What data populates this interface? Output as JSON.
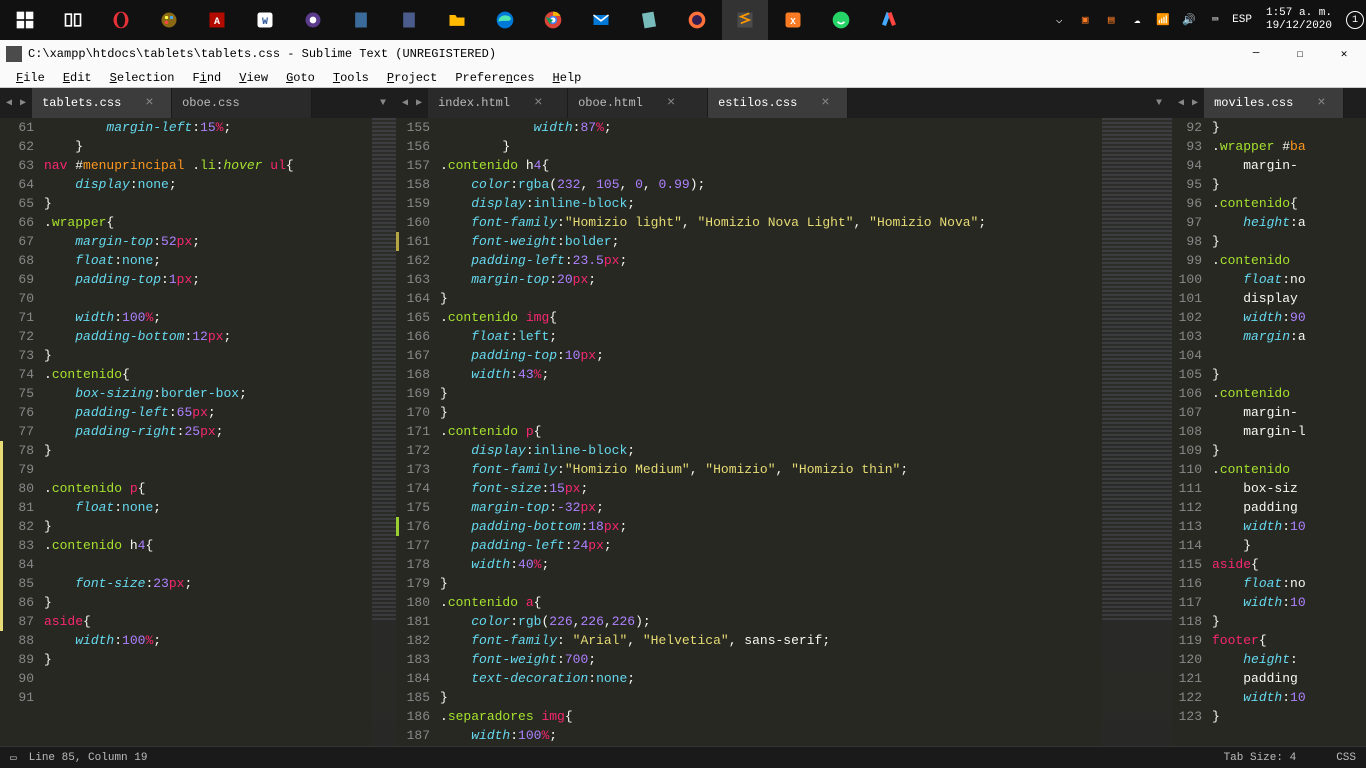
{
  "taskbar": {
    "clock_time": "1:57 a. m.",
    "clock_date": "19/12/2020",
    "lang": "ESP"
  },
  "window": {
    "title": "C:\\xampp\\htdocs\\tablets\\tablets.css - Sublime Text (UNREGISTERED)"
  },
  "menubar": [
    "File",
    "Edit",
    "Selection",
    "Find",
    "View",
    "Goto",
    "Tools",
    "Project",
    "Preferences",
    "Help"
  ],
  "tabgroups": {
    "g1": [
      {
        "label": "tablets.css",
        "active": true,
        "close": true
      },
      {
        "label": "oboe.css",
        "active": false,
        "close": false
      }
    ],
    "g2": [
      {
        "label": "index.html",
        "active": false,
        "close": true
      },
      {
        "label": "oboe.html",
        "active": false,
        "close": true
      },
      {
        "label": "estilos.css",
        "active": true,
        "close": true
      }
    ],
    "g3": [
      {
        "label": "moviles.css",
        "active": true,
        "close": true
      }
    ]
  },
  "statusbar": {
    "left": "Line 85, Column 19",
    "tabsize": "Tab Size: 4",
    "syntax": "CSS"
  },
  "pane1": {
    "start": 61,
    "lines": [
      "        margin-left:15%;",
      "    }",
      "nav #menuprincipal .li:hover ul{",
      "    display:none;",
      "}",
      ".wrapper{",
      "    margin-top:52px;",
      "    float:none;",
      "    padding-top:1px;",
      "",
      "    width:100%;",
      "    padding-bottom:12px;",
      "}",
      ".contenido{",
      "    box-sizing:border-box;",
      "    padding-left:65px;",
      "    padding-right:25px;",
      "}",
      "",
      ".contenido p{",
      "    float:none;",
      "}",
      ".contenido h4{",
      "",
      "    font-size:23px;",
      "}",
      "aside{",
      "    width:100%;",
      "}",
      "",
      ""
    ]
  },
  "pane2": {
    "start": 155,
    "lines": [
      "            width:87%;",
      "        }",
      ".contenido h4{",
      "    color:rgba(232, 105, 0, 0.99);",
      "    display:inline-block;",
      "    font-family:\"Homizio light\", \"Homizio Nova Light\", \"Homizio Nova\";",
      "    font-weight:bolder;",
      "    padding-left:23.5px;",
      "    margin-top:20px;",
      "}",
      ".contenido img{",
      "    float:left;",
      "    padding-top:10px;",
      "    width:43%;",
      "}",
      "}",
      ".contenido p{",
      "    display:inline-block;",
      "    font-family:\"Homizio Medium\", \"Homizio\", \"Homizio thin\";",
      "    font-size:15px;",
      "    margin-top:-32px;",
      "    padding-bottom:18px;",
      "    padding-left:24px;",
      "    width:40%;",
      "}",
      ".contenido a{",
      "    color:rgb(226,226,226);",
      "    font-family: \"Arial\", \"Helvetica\", sans-serif;",
      "    font-weight:700;",
      "    text-decoration:none;",
      "}",
      ".separadores img{",
      "    width:100%;"
    ]
  },
  "pane3": {
    "start": 92,
    "lines": [
      "}",
      ".wrapper #ba",
      "    margin-",
      "}",
      ".contenido{",
      "    height:a",
      "}",
      ".contenido ",
      "    float:no",
      "    display",
      "    width:90",
      "    margin:a",
      "",
      "}",
      ".contenido ",
      "    margin-",
      "    margin-l",
      "}",
      ".contenido ",
      "    box-siz",
      "    padding",
      "    width:10",
      "    }",
      "aside{",
      "    float:no",
      "    width:10",
      "}",
      "footer{",
      "    height:",
      "    padding",
      "    width:10",
      "}"
    ]
  }
}
